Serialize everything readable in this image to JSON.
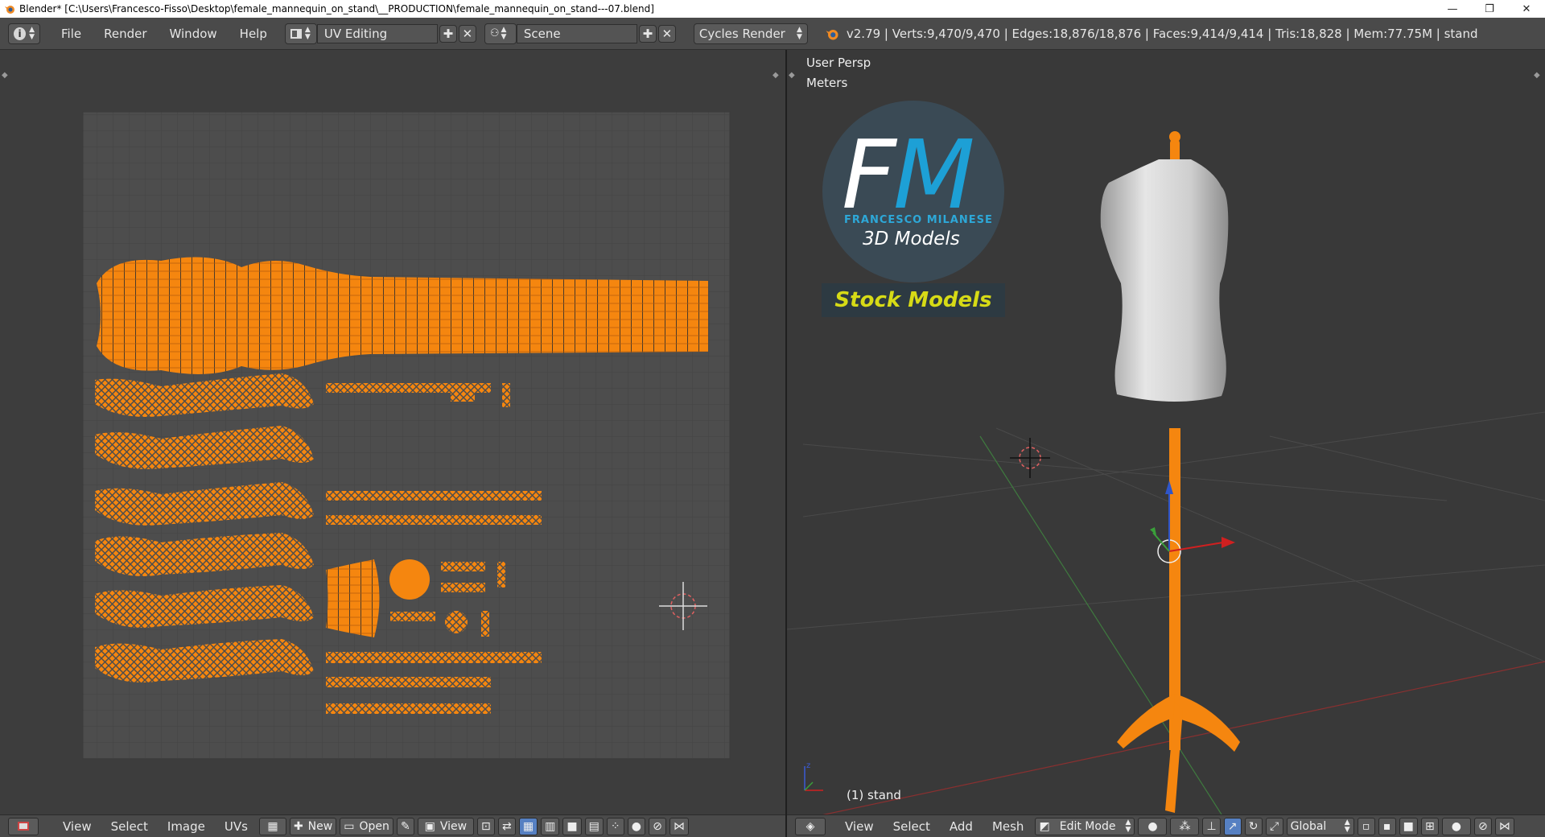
{
  "window": {
    "title": "Blender* [C:\\Users\\Francesco-Fisso\\Desktop\\female_mannequin_on_stand\\__PRODUCTION\\female_mannequin_on_stand---07.blend]",
    "minimize": "—",
    "restore": "❐",
    "close": "✕"
  },
  "topbar": {
    "menus": [
      "File",
      "Render",
      "Window",
      "Help"
    ],
    "screen_layout": "UV Editing",
    "scene": "Scene",
    "render_engine": "Cycles Render",
    "stats": "v2.79 | Verts:9,470/9,470 | Edges:18,876/18,876 | Faces:9,414/9,414 | Tris:18,828 | Mem:77.75M | stand"
  },
  "uv_editor": {
    "menus": [
      "View",
      "Select",
      "Image",
      "UVs"
    ],
    "new_label": "New",
    "open_label": "Open",
    "view_label": "View"
  },
  "viewport": {
    "perspective": "User Persp",
    "units": "Meters",
    "object_label": "(1) stand",
    "menus": [
      "View",
      "Select",
      "Add",
      "Mesh"
    ],
    "mode": "Edit Mode",
    "orientation": "Global"
  },
  "logo": {
    "f": "F",
    "m": "M",
    "name": "FRANCESCO MILANESE",
    "subtitle": "3D Models",
    "banner": "Stock Models"
  },
  "colors": {
    "uv_orange": "#f5860f",
    "accent_blue": "#5680c2",
    "logo_blue": "#1da0d6",
    "logo_yellow": "#d7db16"
  }
}
